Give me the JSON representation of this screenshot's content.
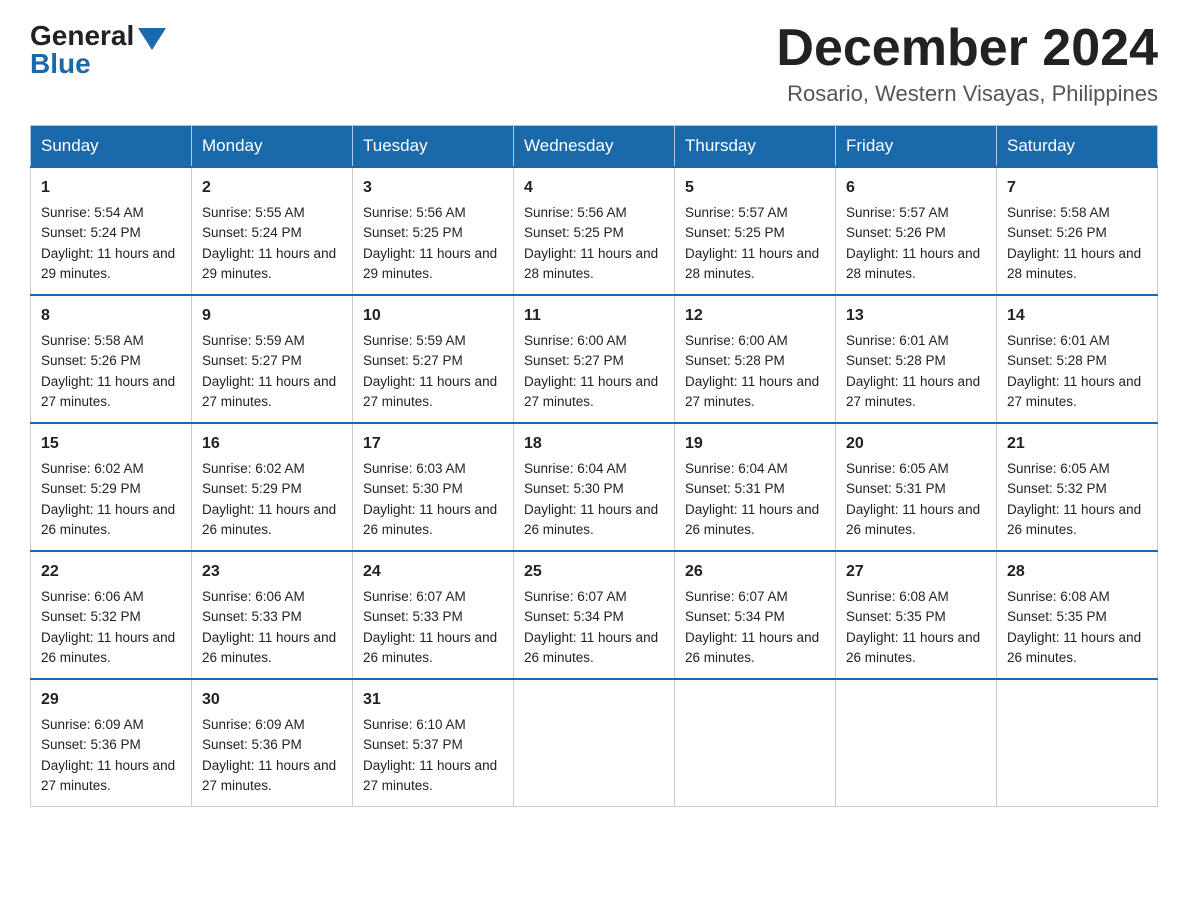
{
  "header": {
    "logo_general": "General",
    "logo_blue": "Blue",
    "month_year": "December 2024",
    "location": "Rosario, Western Visayas, Philippines"
  },
  "days_of_week": [
    "Sunday",
    "Monday",
    "Tuesday",
    "Wednesday",
    "Thursday",
    "Friday",
    "Saturday"
  ],
  "weeks": [
    [
      {
        "day": "1",
        "sunrise": "Sunrise: 5:54 AM",
        "sunset": "Sunset: 5:24 PM",
        "daylight": "Daylight: 11 hours and 29 minutes."
      },
      {
        "day": "2",
        "sunrise": "Sunrise: 5:55 AM",
        "sunset": "Sunset: 5:24 PM",
        "daylight": "Daylight: 11 hours and 29 minutes."
      },
      {
        "day": "3",
        "sunrise": "Sunrise: 5:56 AM",
        "sunset": "Sunset: 5:25 PM",
        "daylight": "Daylight: 11 hours and 29 minutes."
      },
      {
        "day": "4",
        "sunrise": "Sunrise: 5:56 AM",
        "sunset": "Sunset: 5:25 PM",
        "daylight": "Daylight: 11 hours and 28 minutes."
      },
      {
        "day": "5",
        "sunrise": "Sunrise: 5:57 AM",
        "sunset": "Sunset: 5:25 PM",
        "daylight": "Daylight: 11 hours and 28 minutes."
      },
      {
        "day": "6",
        "sunrise": "Sunrise: 5:57 AM",
        "sunset": "Sunset: 5:26 PM",
        "daylight": "Daylight: 11 hours and 28 minutes."
      },
      {
        "day": "7",
        "sunrise": "Sunrise: 5:58 AM",
        "sunset": "Sunset: 5:26 PM",
        "daylight": "Daylight: 11 hours and 28 minutes."
      }
    ],
    [
      {
        "day": "8",
        "sunrise": "Sunrise: 5:58 AM",
        "sunset": "Sunset: 5:26 PM",
        "daylight": "Daylight: 11 hours and 27 minutes."
      },
      {
        "day": "9",
        "sunrise": "Sunrise: 5:59 AM",
        "sunset": "Sunset: 5:27 PM",
        "daylight": "Daylight: 11 hours and 27 minutes."
      },
      {
        "day": "10",
        "sunrise": "Sunrise: 5:59 AM",
        "sunset": "Sunset: 5:27 PM",
        "daylight": "Daylight: 11 hours and 27 minutes."
      },
      {
        "day": "11",
        "sunrise": "Sunrise: 6:00 AM",
        "sunset": "Sunset: 5:27 PM",
        "daylight": "Daylight: 11 hours and 27 minutes."
      },
      {
        "day": "12",
        "sunrise": "Sunrise: 6:00 AM",
        "sunset": "Sunset: 5:28 PM",
        "daylight": "Daylight: 11 hours and 27 minutes."
      },
      {
        "day": "13",
        "sunrise": "Sunrise: 6:01 AM",
        "sunset": "Sunset: 5:28 PM",
        "daylight": "Daylight: 11 hours and 27 minutes."
      },
      {
        "day": "14",
        "sunrise": "Sunrise: 6:01 AM",
        "sunset": "Sunset: 5:28 PM",
        "daylight": "Daylight: 11 hours and 27 minutes."
      }
    ],
    [
      {
        "day": "15",
        "sunrise": "Sunrise: 6:02 AM",
        "sunset": "Sunset: 5:29 PM",
        "daylight": "Daylight: 11 hours and 26 minutes."
      },
      {
        "day": "16",
        "sunrise": "Sunrise: 6:02 AM",
        "sunset": "Sunset: 5:29 PM",
        "daylight": "Daylight: 11 hours and 26 minutes."
      },
      {
        "day": "17",
        "sunrise": "Sunrise: 6:03 AM",
        "sunset": "Sunset: 5:30 PM",
        "daylight": "Daylight: 11 hours and 26 minutes."
      },
      {
        "day": "18",
        "sunrise": "Sunrise: 6:04 AM",
        "sunset": "Sunset: 5:30 PM",
        "daylight": "Daylight: 11 hours and 26 minutes."
      },
      {
        "day": "19",
        "sunrise": "Sunrise: 6:04 AM",
        "sunset": "Sunset: 5:31 PM",
        "daylight": "Daylight: 11 hours and 26 minutes."
      },
      {
        "day": "20",
        "sunrise": "Sunrise: 6:05 AM",
        "sunset": "Sunset: 5:31 PM",
        "daylight": "Daylight: 11 hours and 26 minutes."
      },
      {
        "day": "21",
        "sunrise": "Sunrise: 6:05 AM",
        "sunset": "Sunset: 5:32 PM",
        "daylight": "Daylight: 11 hours and 26 minutes."
      }
    ],
    [
      {
        "day": "22",
        "sunrise": "Sunrise: 6:06 AM",
        "sunset": "Sunset: 5:32 PM",
        "daylight": "Daylight: 11 hours and 26 minutes."
      },
      {
        "day": "23",
        "sunrise": "Sunrise: 6:06 AM",
        "sunset": "Sunset: 5:33 PM",
        "daylight": "Daylight: 11 hours and 26 minutes."
      },
      {
        "day": "24",
        "sunrise": "Sunrise: 6:07 AM",
        "sunset": "Sunset: 5:33 PM",
        "daylight": "Daylight: 11 hours and 26 minutes."
      },
      {
        "day": "25",
        "sunrise": "Sunrise: 6:07 AM",
        "sunset": "Sunset: 5:34 PM",
        "daylight": "Daylight: 11 hours and 26 minutes."
      },
      {
        "day": "26",
        "sunrise": "Sunrise: 6:07 AM",
        "sunset": "Sunset: 5:34 PM",
        "daylight": "Daylight: 11 hours and 26 minutes."
      },
      {
        "day": "27",
        "sunrise": "Sunrise: 6:08 AM",
        "sunset": "Sunset: 5:35 PM",
        "daylight": "Daylight: 11 hours and 26 minutes."
      },
      {
        "day": "28",
        "sunrise": "Sunrise: 6:08 AM",
        "sunset": "Sunset: 5:35 PM",
        "daylight": "Daylight: 11 hours and 26 minutes."
      }
    ],
    [
      {
        "day": "29",
        "sunrise": "Sunrise: 6:09 AM",
        "sunset": "Sunset: 5:36 PM",
        "daylight": "Daylight: 11 hours and 27 minutes."
      },
      {
        "day": "30",
        "sunrise": "Sunrise: 6:09 AM",
        "sunset": "Sunset: 5:36 PM",
        "daylight": "Daylight: 11 hours and 27 minutes."
      },
      {
        "day": "31",
        "sunrise": "Sunrise: 6:10 AM",
        "sunset": "Sunset: 5:37 PM",
        "daylight": "Daylight: 11 hours and 27 minutes."
      },
      null,
      null,
      null,
      null
    ]
  ]
}
